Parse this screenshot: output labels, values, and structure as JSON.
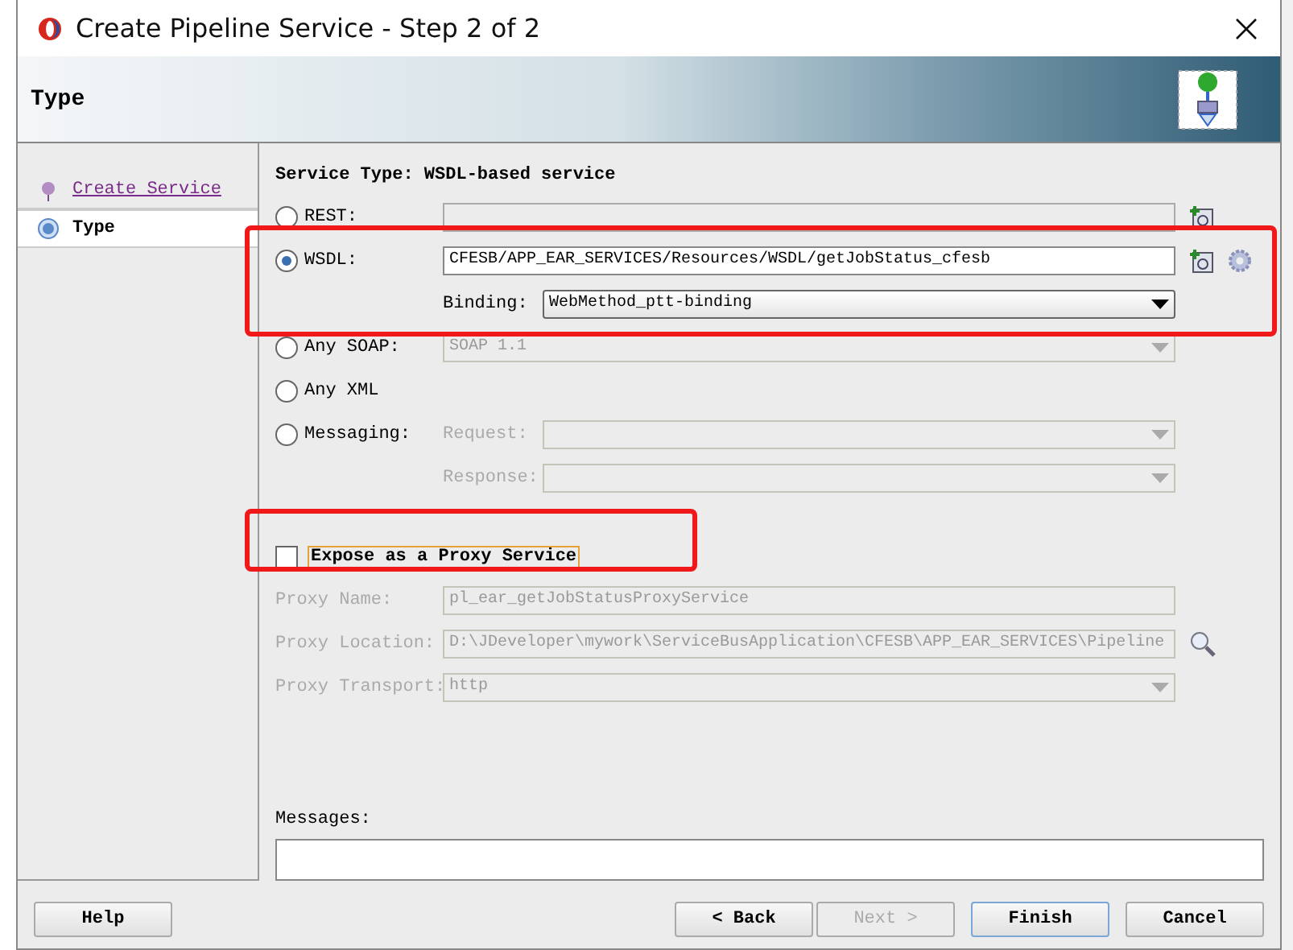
{
  "window": {
    "title": "Create Pipeline Service - Step 2 of 2"
  },
  "header": {
    "title": "Type"
  },
  "steps": [
    {
      "label": "Create Service",
      "selected": false
    },
    {
      "label": "Type",
      "selected": true
    }
  ],
  "service_type": "Service Type: WSDL-based service",
  "options": [
    {
      "kind": "field",
      "label": "REST:",
      "selected": false
    },
    {
      "kind": "field",
      "label": "WSDL:",
      "selected": true,
      "value": "CFESB/APP_EAR_SERVICES/Resources/WSDL/getJobStatus_cfesb",
      "binding": {
        "label": "Binding:",
        "value": "WebMethod_ptt-binding"
      }
    },
    {
      "kind": "dropdown",
      "label": "Any SOAP:",
      "selected": false,
      "value": "SOAP 1.1"
    },
    {
      "kind": "plain",
      "label": "Any XML",
      "selected": false
    },
    {
      "kind": "messaging",
      "label": "Messaging:",
      "selected": false,
      "subfields": [
        {
          "label": "Request:"
        },
        {
          "label": "Response:"
        }
      ]
    }
  ],
  "proxy": {
    "label": "Expose as a Proxy Service",
    "checked": false,
    "fields": [
      {
        "kind": "text",
        "label": "Proxy Name:",
        "value": "pl_ear_getJobStatusProxyService"
      },
      {
        "kind": "browse",
        "label": "Proxy Location:",
        "value": "D:\\JDeveloper\\mywork\\ServiceBusApplication\\CFESB\\APP_EAR_SERVICES\\Pipeline"
      },
      {
        "kind": "dropdown",
        "label": "Proxy Transport:",
        "value": "http"
      }
    ]
  },
  "messages": {
    "label": "Messages:"
  },
  "buttons": [
    {
      "label": "Help",
      "disabled": false,
      "default": false
    },
    {
      "label": "< Back",
      "disabled": false,
      "default": false
    },
    {
      "label": "Next >",
      "disabled": true,
      "default": false
    },
    {
      "label": "Finish",
      "disabled": false,
      "default": true
    },
    {
      "label": "Cancel",
      "disabled": false,
      "default": false
    }
  ]
}
